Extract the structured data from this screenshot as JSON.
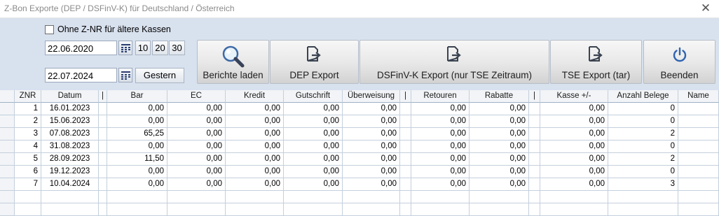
{
  "window": {
    "title": "Z-Bon Exporte (DEP / DSFinV-K) für Deutschland / Österreich",
    "close_icon": "close-icon"
  },
  "options": {
    "no_znr_label": "Ohne Z-NR für ältere Kassen",
    "no_znr_checked": false
  },
  "dates": {
    "from": "22.06.2020",
    "to": "22.07.2024"
  },
  "quick_buttons": {
    "b10": "10",
    "b20": "20",
    "b30": "30",
    "yesterday": "Gestern"
  },
  "actions": {
    "load_reports": "Berichte laden",
    "dep_export": "DEP Export",
    "dsfinvk_export": "DSFinV-K Export (nur TSE Zeitraum)",
    "tse_export": "TSE Export (tar)",
    "quit": "Beenden"
  },
  "table": {
    "columns": [
      "ZNR",
      "Datum",
      "|",
      "Bar",
      "EC",
      "Kredit",
      "Gutschrift",
      "Überweisung",
      "|",
      "Retouren",
      "Rabatte",
      "|",
      "Kasse +/-",
      "Anzahl Belege",
      "Name"
    ],
    "rows": [
      [
        "1",
        "16.01.2023",
        "",
        "0,00",
        "0,00",
        "0,00",
        "0,00",
        "0,00",
        "",
        "0,00",
        "0,00",
        "",
        "0,00",
        "0",
        ""
      ],
      [
        "2",
        "15.06.2023",
        "",
        "0,00",
        "0,00",
        "0,00",
        "0,00",
        "0,00",
        "",
        "0,00",
        "0,00",
        "",
        "0,00",
        "0",
        ""
      ],
      [
        "3",
        "07.08.2023",
        "",
        "65,25",
        "0,00",
        "0,00",
        "0,00",
        "0,00",
        "",
        "0,00",
        "0,00",
        "",
        "0,00",
        "2",
        ""
      ],
      [
        "4",
        "31.08.2023",
        "",
        "0,00",
        "0,00",
        "0,00",
        "0,00",
        "0,00",
        "",
        "0,00",
        "0,00",
        "",
        "0,00",
        "0",
        ""
      ],
      [
        "5",
        "28.09.2023",
        "",
        "11,50",
        "0,00",
        "0,00",
        "0,00",
        "0,00",
        "",
        "0,00",
        "0,00",
        "",
        "0,00",
        "2",
        ""
      ],
      [
        "6",
        "19.12.2023",
        "",
        "0,00",
        "0,00",
        "0,00",
        "0,00",
        "0,00",
        "",
        "0,00",
        "0,00",
        "",
        "0,00",
        "0",
        ""
      ],
      [
        "7",
        "10.04.2024",
        "",
        "0,00",
        "0,00",
        "0,00",
        "0,00",
        "0,00",
        "",
        "0,00",
        "0,00",
        "",
        "0,00",
        "3",
        ""
      ]
    ]
  }
}
